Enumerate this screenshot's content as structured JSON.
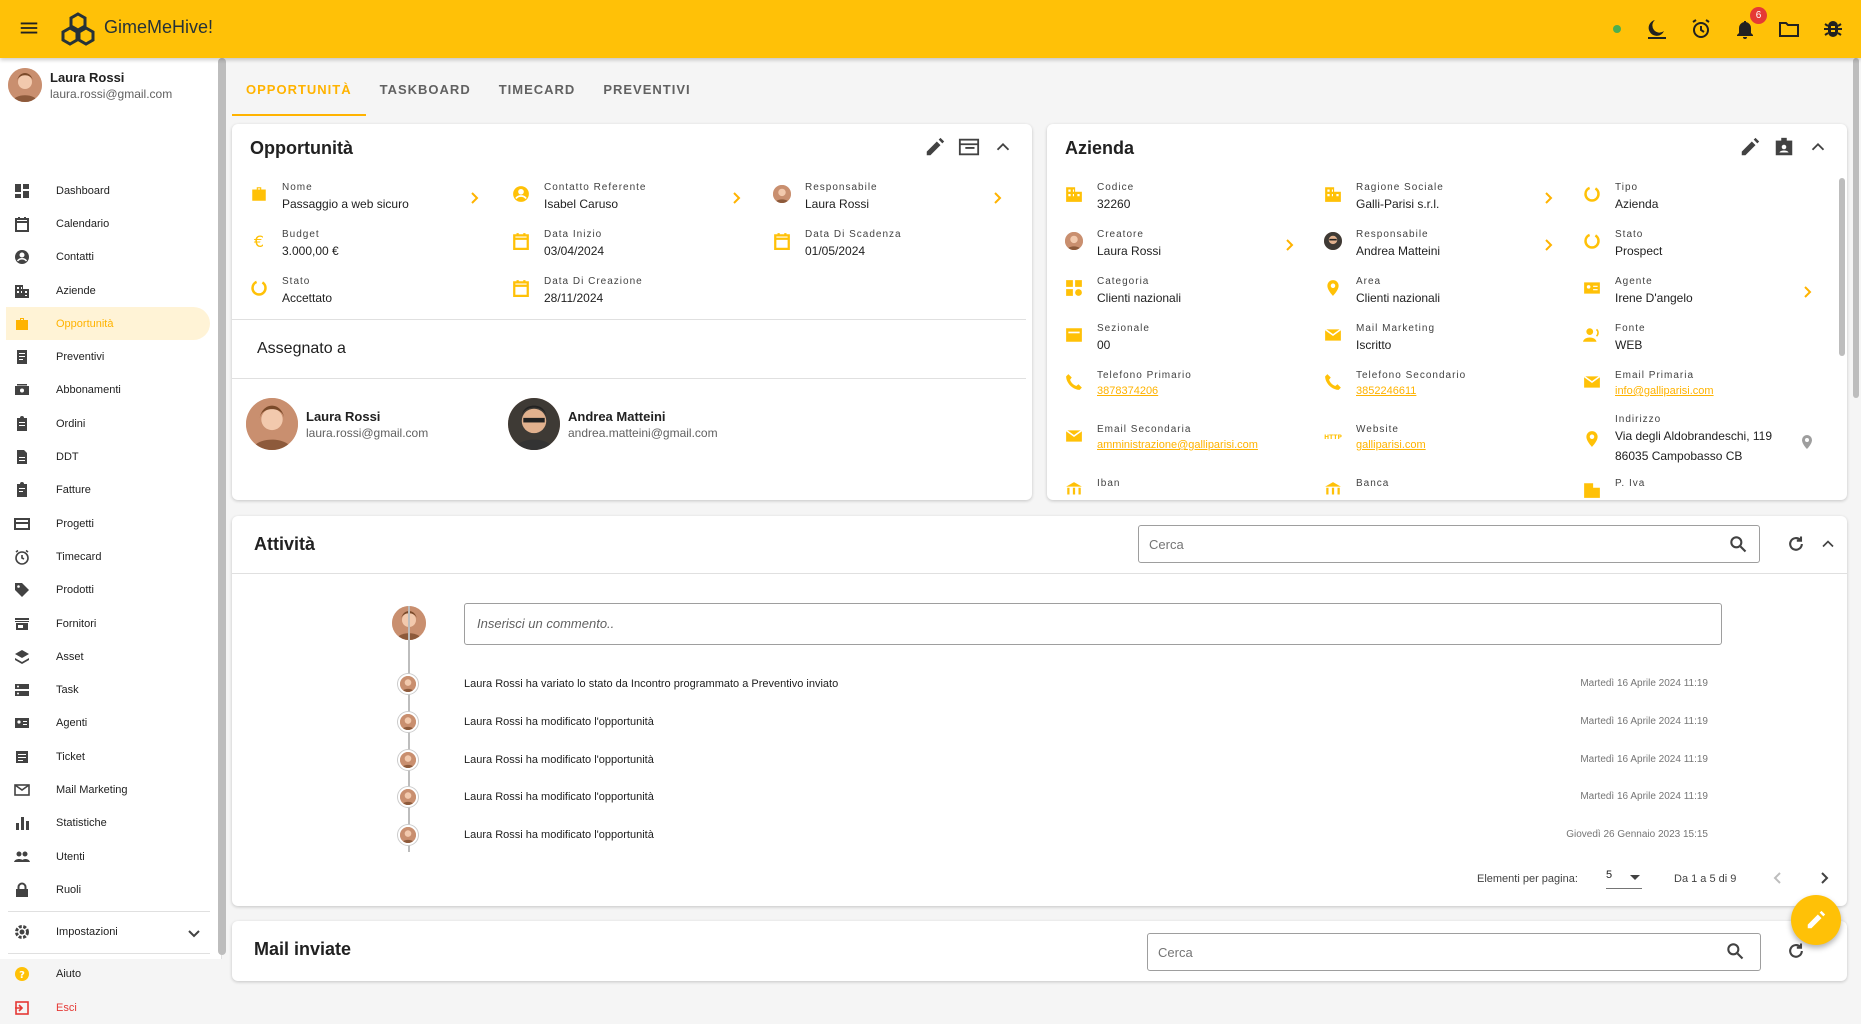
{
  "app": {
    "name": "GimeMeHive!",
    "notifications": "6"
  },
  "user": {
    "name": "Laura Rossi",
    "email": "laura.rossi@gmail.com"
  },
  "nav": [
    {
      "label": "Dashboard",
      "icon": "dashboard-icon"
    },
    {
      "label": "Calendario",
      "icon": "calendar-icon"
    },
    {
      "label": "Contatti",
      "icon": "contact-icon"
    },
    {
      "label": "Aziende",
      "icon": "building-icon"
    },
    {
      "label": "Opportunità",
      "icon": "briefcase-icon"
    },
    {
      "label": "Preventivi",
      "icon": "quote-icon"
    },
    {
      "label": "Abbonamenti",
      "icon": "subscription-icon"
    },
    {
      "label": "Ordini",
      "icon": "clipboard-icon"
    },
    {
      "label": "DDT",
      "icon": "document-icon"
    },
    {
      "label": "Fatture",
      "icon": "invoice-icon"
    },
    {
      "label": "Progetti",
      "icon": "project-icon"
    },
    {
      "label": "Timecard",
      "icon": "clock-icon"
    },
    {
      "label": "Prodotti",
      "icon": "tag-icon"
    },
    {
      "label": "Fornitori",
      "icon": "store-icon"
    },
    {
      "label": "Asset",
      "icon": "layers-icon"
    },
    {
      "label": "Task",
      "icon": "task-icon"
    },
    {
      "label": "Agenti",
      "icon": "agent-icon"
    },
    {
      "label": "Ticket",
      "icon": "ticket-icon"
    },
    {
      "label": "Mail Marketing",
      "icon": "mail-icon"
    },
    {
      "label": "Statistiche",
      "icon": "chart-icon"
    },
    {
      "label": "Utenti",
      "icon": "people-icon"
    },
    {
      "label": "Ruoli",
      "icon": "lock-icon"
    }
  ],
  "nav_settings": "Impostazioni",
  "nav_help": "Aiuto",
  "nav_exit": "Esci",
  "tabs": [
    "OPPORTUNITÀ",
    "TASKBOARD",
    "TIMECARD",
    "PREVENTIVI"
  ],
  "opportunity": {
    "title": "Opportunità",
    "fields": {
      "nome": {
        "label": "Nome",
        "value": "Passaggio a web sicuro"
      },
      "contatto": {
        "label": "Contatto Referente",
        "value": "Isabel Caruso"
      },
      "responsabile": {
        "label": "Responsabile",
        "value": "Laura Rossi"
      },
      "budget": {
        "label": "Budget",
        "value": "3.000,00 €"
      },
      "inizio": {
        "label": "Data Inizio",
        "value": "03/04/2024"
      },
      "scadenza": {
        "label": "Data Di Scadenza",
        "value": "01/05/2024"
      },
      "stato": {
        "label": "Stato",
        "value": "Accettato"
      },
      "creazione": {
        "label": "Data Di Creazione",
        "value": "28/11/2024"
      }
    },
    "assigned_title": "Assegnato a",
    "assignees": [
      {
        "name": "Laura Rossi",
        "email": "laura.rossi@gmail.com"
      },
      {
        "name": "Andrea Matteini",
        "email": "andrea.matteini@gmail.com"
      }
    ]
  },
  "company": {
    "title": "Azienda",
    "fields": {
      "codice": {
        "label": "Codice",
        "value": "32260"
      },
      "ragione": {
        "label": "Ragione Sociale",
        "value": "Galli-Parisi s.r.l."
      },
      "tipo": {
        "label": "Tipo",
        "value": "Azienda"
      },
      "creatore": {
        "label": "Creatore",
        "value": "Laura Rossi"
      },
      "responsabile": {
        "label": "Responsabile",
        "value": "Andrea Matteini"
      },
      "stato": {
        "label": "Stato",
        "value": "Prospect"
      },
      "categoria": {
        "label": "Categoria",
        "value": "Clienti nazionali"
      },
      "area": {
        "label": "Area",
        "value": "Clienti nazionali"
      },
      "agente": {
        "label": "Agente",
        "value": "Irene D'angelo"
      },
      "sezionale": {
        "label": "Sezionale",
        "value": "00"
      },
      "mail_marketing": {
        "label": "Mail Marketing",
        "value": "Iscritto"
      },
      "fonte": {
        "label": "Fonte",
        "value": "WEB"
      },
      "tel1": {
        "label": "Telefono Primario",
        "value": "3878374206"
      },
      "tel2": {
        "label": "Telefono Secondario",
        "value": "3852246611"
      },
      "email1": {
        "label": "Email Primaria",
        "value": "info@galliparisi.com"
      },
      "email2": {
        "label": "Email Secondaria",
        "value": "amministrazione@galliparisi.com"
      },
      "website": {
        "label": "Website",
        "value": "galliparisi.com"
      },
      "indirizzo": {
        "label": "Indirizzo",
        "value": "Via degli Aldobrandeschi, 119",
        "value2": "86035 Campobasso CB"
      },
      "iban": {
        "label": "Iban"
      },
      "banca": {
        "label": "Banca"
      },
      "piva": {
        "label": "P. Iva"
      }
    }
  },
  "activity": {
    "title": "Attività",
    "search_placeholder": "Cerca",
    "comment_placeholder": "Inserisci un commento..",
    "items": [
      {
        "text": "Laura Rossi ha variato lo stato da Incontro programmato a Preventivo inviato",
        "date": "Martedì 16 Aprile 2024 11:19"
      },
      {
        "text": "Laura Rossi ha modificato l'opportunità",
        "date": "Martedì 16 Aprile 2024 11:19"
      },
      {
        "text": "Laura Rossi ha modificato l'opportunità",
        "date": "Martedì 16 Aprile 2024 11:19"
      },
      {
        "text": "Laura Rossi ha modificato l'opportunità",
        "date": "Martedì 16 Aprile 2024 11:19"
      },
      {
        "text": "Laura Rossi ha modificato l'opportunità",
        "date": "Giovedì 26 Gennaio 2023 15:15"
      }
    ],
    "per_page_label": "Elementi per pagina:",
    "per_page_value": "5",
    "range": "Da 1 a 5 di 9"
  },
  "mail": {
    "title": "Mail inviate",
    "search_placeholder": "Cerca"
  },
  "colors": {
    "accent": "#ffc107",
    "accent_text": "#ffb300",
    "danger": "#e53935"
  }
}
